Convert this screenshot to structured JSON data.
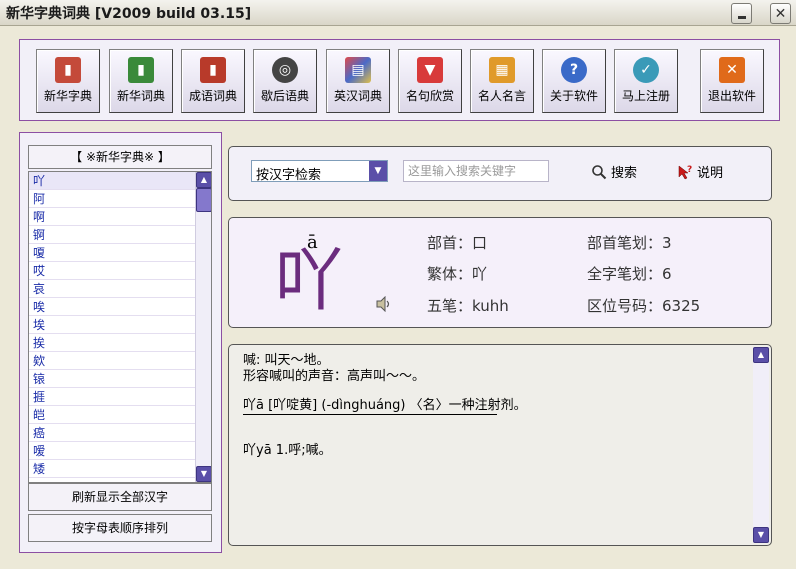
{
  "window": {
    "title": "新华字典词典  [V2009 build 03.15]"
  },
  "toolbar": {
    "buttons": [
      {
        "label": "新华字典",
        "icon": "book-red-icon",
        "color": "#c44a3a"
      },
      {
        "label": "新华词典",
        "icon": "book-green-icon",
        "color": "#3a8a3a"
      },
      {
        "label": "成语词典",
        "icon": "book-red-dict-icon",
        "color": "#b83a2a"
      },
      {
        "label": "歇后语典",
        "icon": "film-reel-icon",
        "color": "#444444"
      },
      {
        "label": "英汉词典",
        "icon": "colorful-book-icon",
        "color": "#4a6ac8"
      },
      {
        "label": "名句欣赏",
        "icon": "filter-funnel-icon",
        "color": "#d83a3a"
      },
      {
        "label": "名人名言",
        "icon": "blocks-icon",
        "color": "#e09a2a"
      },
      {
        "label": "关于软件",
        "icon": "help-globe-icon",
        "color": "#3a6ac8"
      },
      {
        "label": "马上注册",
        "icon": "register-disc-icon",
        "color": "#3a9ab8"
      },
      {
        "label": "退出软件",
        "icon": "exit-x-icon",
        "color": "#e06a1a"
      }
    ]
  },
  "sidebar": {
    "header": "【 ※新华字典※ 】",
    "items": [
      "吖",
      "阿",
      "啊",
      "锕",
      "嗄",
      "哎",
      "哀",
      "唉",
      "埃",
      "挨",
      "欸",
      "锿",
      "捱",
      "皑",
      "癌",
      "嗳",
      "矮"
    ],
    "refresh_label": "刷新显示全部汉字",
    "sort_label": "按字母表顺序排列"
  },
  "search": {
    "mode": "按汉字检索",
    "placeholder": "这里输入搜索关键字",
    "search_label": "搜索",
    "help_label": "说明"
  },
  "entry": {
    "character": "吖",
    "pinyin": "ā",
    "radical": "部首：口",
    "radical_strokes": "部首笔划：3",
    "traditional": "繁体：吖",
    "total_strokes": "全字笔划：6",
    "wubi": "五笔：kuhh",
    "area_code": "区位号码：6325"
  },
  "definition": {
    "lines": [
      "喊: 叫天～地。",
      "形容喊叫的声音：高声叫～～。",
      "吖ā [吖啶黄] (-dìnghuáng) 〈名〉一种注射剂。",
      "吖yā 1.呼;喊。"
    ]
  }
}
